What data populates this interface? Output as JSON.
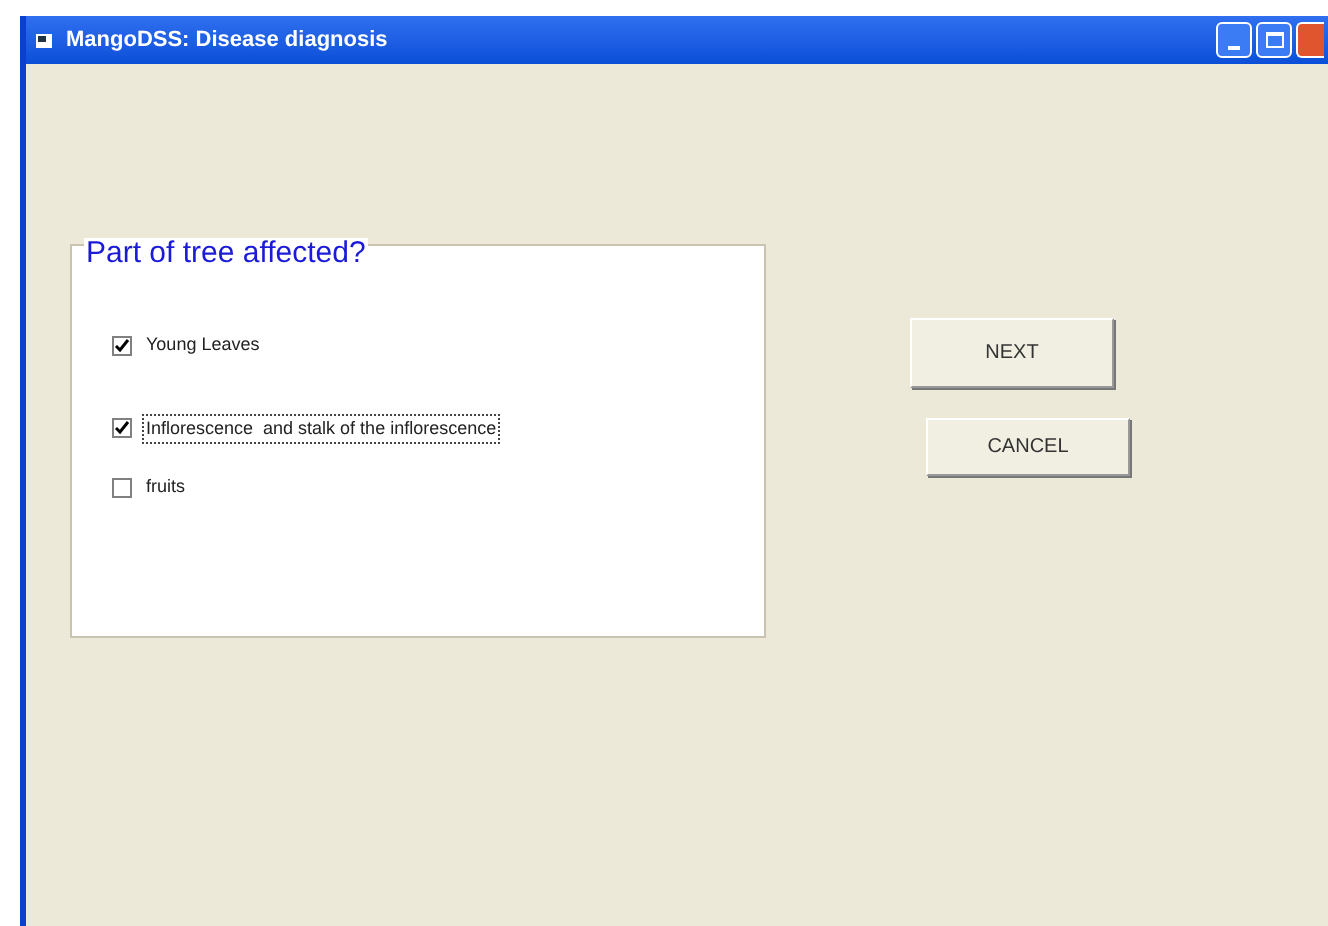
{
  "window": {
    "title": "MangoDSS: Disease diagnosis"
  },
  "group": {
    "title": "Part of tree affected?",
    "options": [
      {
        "label": "Young Leaves",
        "checked": true,
        "focused": false
      },
      {
        "label": "Inflorescence  and stalk of the inflorescence",
        "checked": true,
        "focused": true
      },
      {
        "label": "fruits",
        "checked": false,
        "focused": false
      }
    ]
  },
  "buttons": [
    "NEXT",
    "CANCEL"
  ]
}
